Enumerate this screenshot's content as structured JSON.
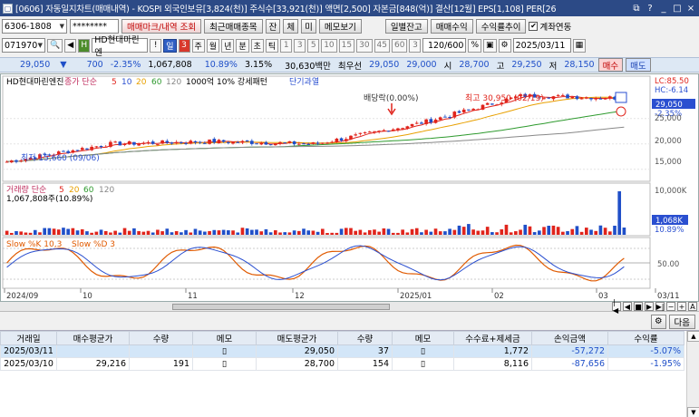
{
  "window": {
    "title": "[0606] 자동일지차트(매매내역) - KOSPI 외국인보유[3,824(천)] 주식수[33,921(천)] 액면[2,500] 자본금[848(억)] 결산[12월] EPS[1,108] PER[26"
  },
  "toolbar": {
    "account": "6306-1808",
    "password": "********",
    "btn_trade_mark": "매매마크/내역 조회",
    "btn_recent": "최근매매종목",
    "btn_jan": "잔",
    "btn_che": "체",
    "btn_mi": "미",
    "btn_memo": "메모보기",
    "btn_daily_balance": "일별잔고",
    "btn_trade_profit": "매매수익",
    "btn_profit_trend": "수익률추이",
    "chk_account_link": "계좌연동",
    "chk_mark": "✔"
  },
  "toolbar2": {
    "stock_code": "071970",
    "stock_name": "HD현대마린엔",
    "periods": [
      "!",
      "일",
      "3",
      "주",
      "월",
      "년",
      "분",
      "초",
      "틱"
    ],
    "minutes": [
      "1",
      "3",
      "5",
      "10",
      "15",
      "30",
      "45",
      "60",
      "3"
    ],
    "count": "120",
    "total": "/600",
    "date": "2025/03/11"
  },
  "quote": {
    "price": "29,050",
    "arrow": "▼",
    "change": "700",
    "pct": "-2.35%",
    "volume": "1,067,808",
    "vol_ratio": "10.89%",
    "turnover": "3.15%",
    "amount": "30,630백만",
    "ask_label": "최우선",
    "ask": "29,050",
    "bid": "29,000",
    "open_label": "시",
    "open": "28,700",
    "high_label": "고",
    "high": "29,250",
    "low_label": "저",
    "low": "28,150",
    "sell": "매수",
    "buy": "매도"
  },
  "chart": {
    "legend_name": "HD현대마린엔진",
    "legend_ma": "종가 단순",
    "ma_periods": [
      "5",
      "10",
      "20",
      "60",
      "120"
    ],
    "legend_unit": "1000억 10% 강세패턴",
    "legend_trend": "단기과열",
    "lc": "LC:85.50",
    "hc": "HC:-6.14",
    "price_ticks": [
      "25,000",
      "20,000",
      "15,000"
    ],
    "last_price": "29,050",
    "change_label": "-2.35%",
    "annotation_div": "배당락(0.00%)",
    "annotation_high": "최고 30,950 (02/19)",
    "annotation_low": "최저 15,660 (09/06)",
    "vol_legend": "거래량 단순",
    "vol_ma": [
      "5",
      "20",
      "60",
      "120"
    ],
    "vol_value": "1,067,808주(10.89%)",
    "vol_ticks": [
      "10,000K"
    ],
    "vol_last": "1,068K",
    "vol_pct": "10.89%",
    "stoch_legend_k": "Slow %K 10,3",
    "stoch_legend_d": "Slow %D 3",
    "stoch_tick": "50.00",
    "x_labels": [
      "2024/09",
      "10",
      "11",
      "12",
      "2025/01",
      "02",
      "03",
      "03/11"
    ]
  },
  "chart_data": {
    "type": "line",
    "title": "HD현대마린엔진",
    "x": [
      "2024/09",
      "10",
      "11",
      "12",
      "2025/01",
      "02",
      "03"
    ],
    "series": [
      {
        "name": "종가",
        "values": [
          16500,
          20000,
          20500,
          20000,
          24000,
          29500,
          29050
        ]
      }
    ],
    "ylim": [
      13000,
      33000
    ],
    "yticks": [
      15000,
      20000,
      25000
    ]
  },
  "grid": {
    "headers": [
      "거래일",
      "매수평균가",
      "수량",
      "메모",
      "매도평균가",
      "수량",
      "메모",
      "수수료+제세금",
      "손익금액",
      "수익률"
    ],
    "rows": [
      {
        "date": "2025/03/11",
        "buy_avg": "",
        "buy_qty": "",
        "sell_avg": "29,050",
        "sell_qty": "37",
        "fee": "1,772",
        "pl": "-57,272",
        "rate": "-5.07%"
      },
      {
        "date": "2025/03/10",
        "buy_avg": "29,216",
        "buy_qty": "191",
        "sell_avg": "28,700",
        "sell_qty": "154",
        "fee": "8,116",
        "pl": "-87,656",
        "rate": "-1.95%"
      }
    ],
    "next_btn": "다음"
  },
  "colors": {
    "up": "#e0241c",
    "down": "#1f4fc8",
    "ma5": "#e0241c",
    "ma20": "#e8a000",
    "ma60": "#2e9a2e",
    "ma120": "#888888",
    "stoch_k": "#e05a00",
    "stoch_d": "#2a4fd0"
  }
}
